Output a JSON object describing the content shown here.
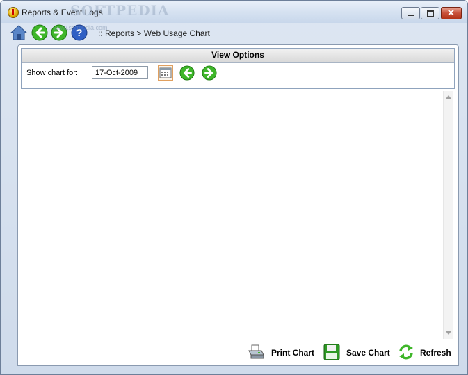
{
  "window": {
    "title": "Reports & Event Logs",
    "watermark": "SOFTPEDIA"
  },
  "toolbar": {
    "breadcrumb": ":: Reports > Web Usage Chart",
    "watermark_small": "www.softpedia.com",
    "icons": [
      "home-icon",
      "back-arrow-icon",
      "forward-arrow-icon",
      "help-icon"
    ]
  },
  "view_options": {
    "header": "View Options",
    "show_chart_label": "Show chart for:",
    "date_value": "17-Oct-2009"
  },
  "actions": {
    "print_label": "Print Chart",
    "save_label": "Save Chart",
    "refresh_label": "Refresh"
  },
  "colors": {
    "arrow_green": "#3fb62a",
    "help_blue": "#2f5fc4",
    "panel_border": "#8fa3bd"
  }
}
